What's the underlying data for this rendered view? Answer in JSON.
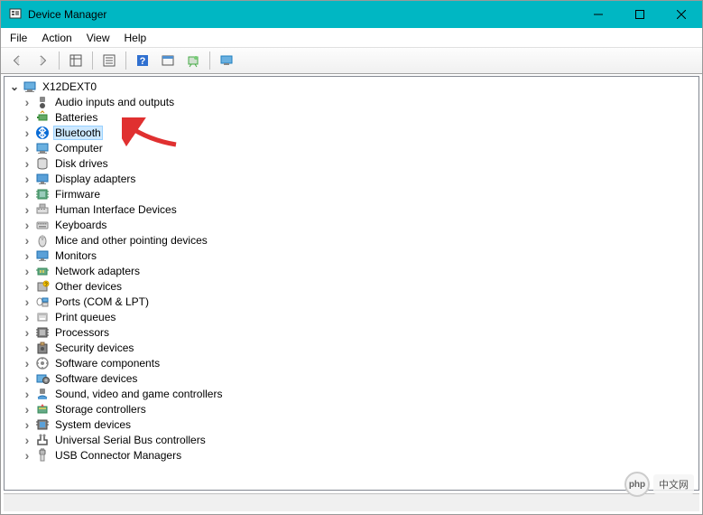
{
  "window": {
    "title": "Device Manager"
  },
  "menu": {
    "file": "File",
    "action": "Action",
    "view": "View",
    "help": "Help"
  },
  "tree": {
    "root": "X12DEXT0",
    "items": [
      "Audio inputs and outputs",
      "Batteries",
      "Bluetooth",
      "Computer",
      "Disk drives",
      "Display adapters",
      "Firmware",
      "Human Interface Devices",
      "Keyboards",
      "Mice and other pointing devices",
      "Monitors",
      "Network adapters",
      "Other devices",
      "Ports (COM & LPT)",
      "Print queues",
      "Processors",
      "Security devices",
      "Software components",
      "Software devices",
      "Sound, video and game controllers",
      "Storage controllers",
      "System devices",
      "Universal Serial Bus controllers",
      "USB Connector Managers"
    ],
    "selected_index": 2
  },
  "watermark": {
    "badge": "php",
    "text": "中文网"
  }
}
